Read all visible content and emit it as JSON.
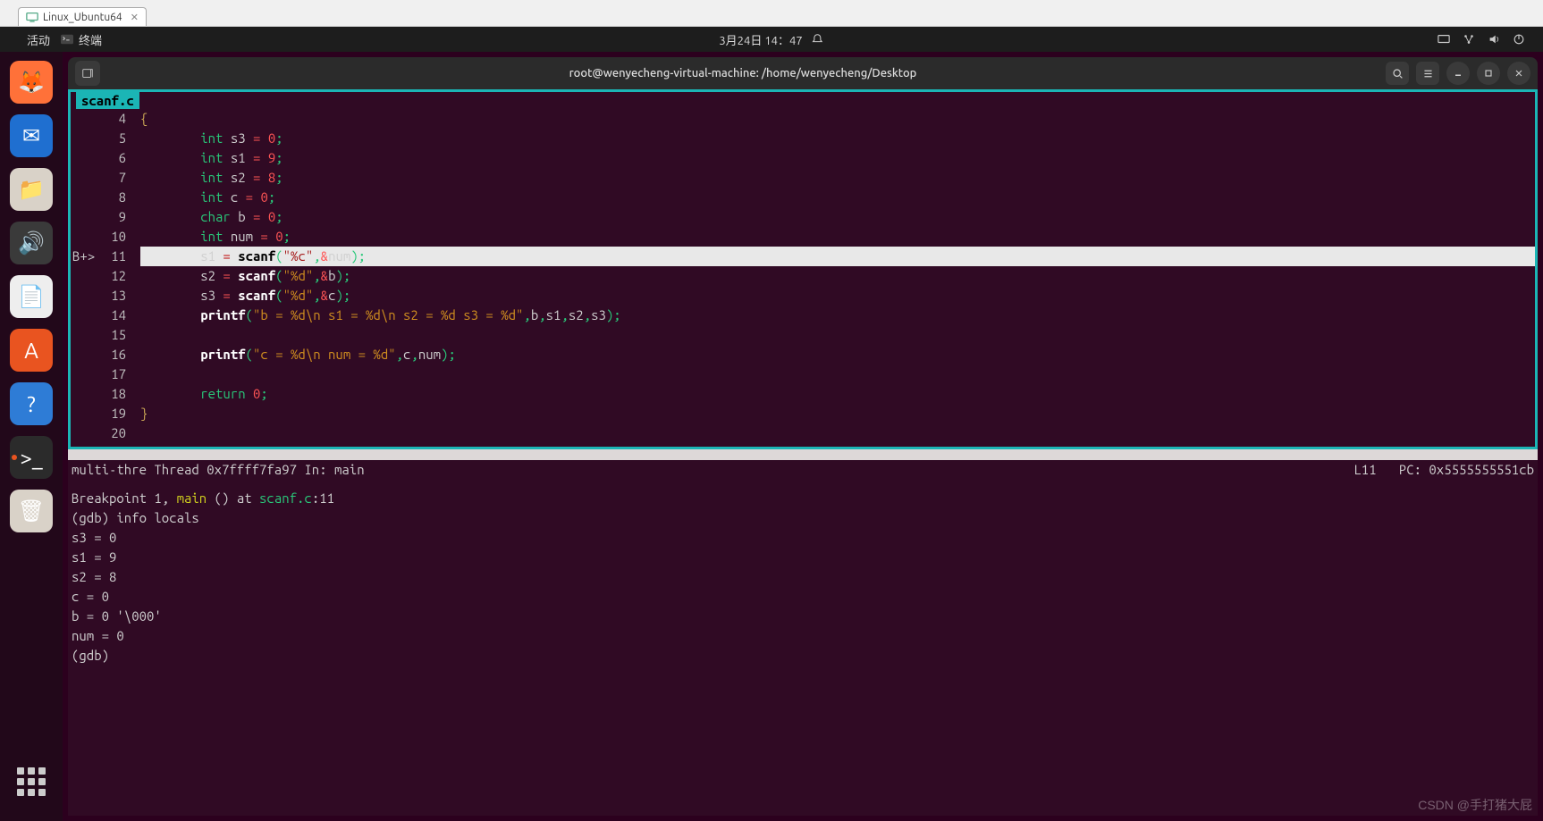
{
  "vm_tab": {
    "label": "Linux_Ubuntu64"
  },
  "topbar": {
    "activities": "活动",
    "app": "终端",
    "datetime": "3月24日  14：47"
  },
  "dock": {
    "items": [
      {
        "name": "firefox",
        "bg": "#ff7139",
        "glyph": "🦊"
      },
      {
        "name": "thunderbird",
        "bg": "#1f6fd0",
        "glyph": "✉"
      },
      {
        "name": "files",
        "bg": "#d9d2c8",
        "glyph": "📁"
      },
      {
        "name": "rhythmbox",
        "bg": "#3a3a3a",
        "glyph": "🔊"
      },
      {
        "name": "libreoffice",
        "bg": "#eeeeee",
        "glyph": "📄"
      },
      {
        "name": "software",
        "bg": "#e95420",
        "glyph": "A"
      },
      {
        "name": "help",
        "bg": "#2e7cd6",
        "glyph": "?"
      },
      {
        "name": "terminal",
        "bg": "#2b2b2b",
        "glyph": ">_",
        "active": true
      },
      {
        "name": "trash",
        "bg": "#d9d2c8",
        "glyph": "🗑"
      }
    ]
  },
  "terminal": {
    "title": "root@wenyecheng-virtual-machine: /home/wenyecheng/Desktop",
    "file_tab": "scanf.c",
    "code": [
      {
        "n": 4,
        "html": "<span class='tok-brace'>{</span>"
      },
      {
        "n": 5,
        "html": "        <span class='tok-type'>int</span> <span class='tok-id'>s3</span> <span class='tok-op'>=</span> <span class='tok-num'>0</span><span class='tok-punc'>;</span>"
      },
      {
        "n": 6,
        "html": "        <span class='tok-type'>int</span> <span class='tok-id'>s1</span> <span class='tok-op'>=</span> <span class='tok-num'>9</span><span class='tok-punc'>;</span>"
      },
      {
        "n": 7,
        "html": "        <span class='tok-type'>int</span> <span class='tok-id'>s2</span> <span class='tok-op'>=</span> <span class='tok-num'>8</span><span class='tok-punc'>;</span>"
      },
      {
        "n": 8,
        "html": "        <span class='tok-type'>int</span> <span class='tok-id'>c</span> <span class='tok-op'>=</span> <span class='tok-num'>0</span><span class='tok-punc'>;</span>"
      },
      {
        "n": 9,
        "html": "        <span class='tok-type'>char</span> <span class='tok-id'>b</span> <span class='tok-op'>=</span> <span class='tok-num'>0</span><span class='tok-punc'>;</span>"
      },
      {
        "n": 10,
        "html": "        <span class='tok-type'>int</span> <span class='tok-id'>num</span> <span class='tok-op'>=</span> <span class='tok-num'>0</span><span class='tok-punc'>;</span>"
      },
      {
        "n": 11,
        "marker": "B+>",
        "current": true,
        "html": "        <span class='tok-id'>s1</span> <span class='tok-op'>=</span> <span class='tok-fn'>scanf</span><span class='tok-punc'>(</span><span class='tok-str'>\"%c\"</span><span class='tok-punc'>,</span><span class='tok-amp'>&amp;</span><span class='tok-id'>num</span><span class='tok-punc'>);</span>"
      },
      {
        "n": 12,
        "html": "        <span class='tok-id'>s2</span> <span class='tok-op'>=</span> <span class='tok-fn'>scanf</span><span class='tok-punc'>(</span><span class='tok-str'>\"%d\"</span><span class='tok-punc'>,</span><span class='tok-amp'>&amp;</span><span class='tok-id'>b</span><span class='tok-punc'>);</span>"
      },
      {
        "n": 13,
        "html": "        <span class='tok-id'>s3</span> <span class='tok-op'>=</span> <span class='tok-fn'>scanf</span><span class='tok-punc'>(</span><span class='tok-str'>\"%d\"</span><span class='tok-punc'>,</span><span class='tok-amp'>&amp;</span><span class='tok-id'>c</span><span class='tok-punc'>);</span>"
      },
      {
        "n": 14,
        "html": "        <span class='tok-fn'>printf</span><span class='tok-punc'>(</span><span class='tok-str'>\"b = %d\\n s1 = %d\\n s2 = %d s3 = %d\"</span><span class='tok-punc'>,</span><span class='tok-id'>b</span><span class='tok-punc'>,</span><span class='tok-id'>s1</span><span class='tok-punc'>,</span><span class='tok-id'>s2</span><span class='tok-punc'>,</span><span class='tok-id'>s3</span><span class='tok-punc'>);</span>"
      },
      {
        "n": 15,
        "html": ""
      },
      {
        "n": 16,
        "html": "        <span class='tok-fn'>printf</span><span class='tok-punc'>(</span><span class='tok-str'>\"c = %d\\n num = %d\"</span><span class='tok-punc'>,</span><span class='tok-id'>c</span><span class='tok-punc'>,</span><span class='tok-id'>num</span><span class='tok-punc'>);</span>"
      },
      {
        "n": 17,
        "html": ""
      },
      {
        "n": 18,
        "html": "        <span class='tok-kw'>return</span> <span class='tok-num'>0</span><span class='tok-punc'>;</span>"
      },
      {
        "n": 19,
        "html": "<span class='tok-brace'>}</span>"
      },
      {
        "n": 20,
        "html": ""
      }
    ],
    "thread_left": "multi-thre Thread 0x7ffff7fa97 In: main",
    "thread_right": "L11   PC: 0x5555555551cb",
    "gdb_lines": [
      {
        "html": "Breakpoint 1, <span class='fn-hl'>main</span> () at <span class='file-hl'>scanf.c</span>:11"
      },
      {
        "html": "(gdb) info locals"
      },
      {
        "html": "s3 = 0"
      },
      {
        "html": "s1 = 9"
      },
      {
        "html": "s2 = 8"
      },
      {
        "html": "c = 0"
      },
      {
        "html": "b = 0 '\\000'"
      },
      {
        "html": "num = 0"
      },
      {
        "html": "(gdb) "
      }
    ]
  },
  "watermark": "CSDN @手打猪大屁"
}
